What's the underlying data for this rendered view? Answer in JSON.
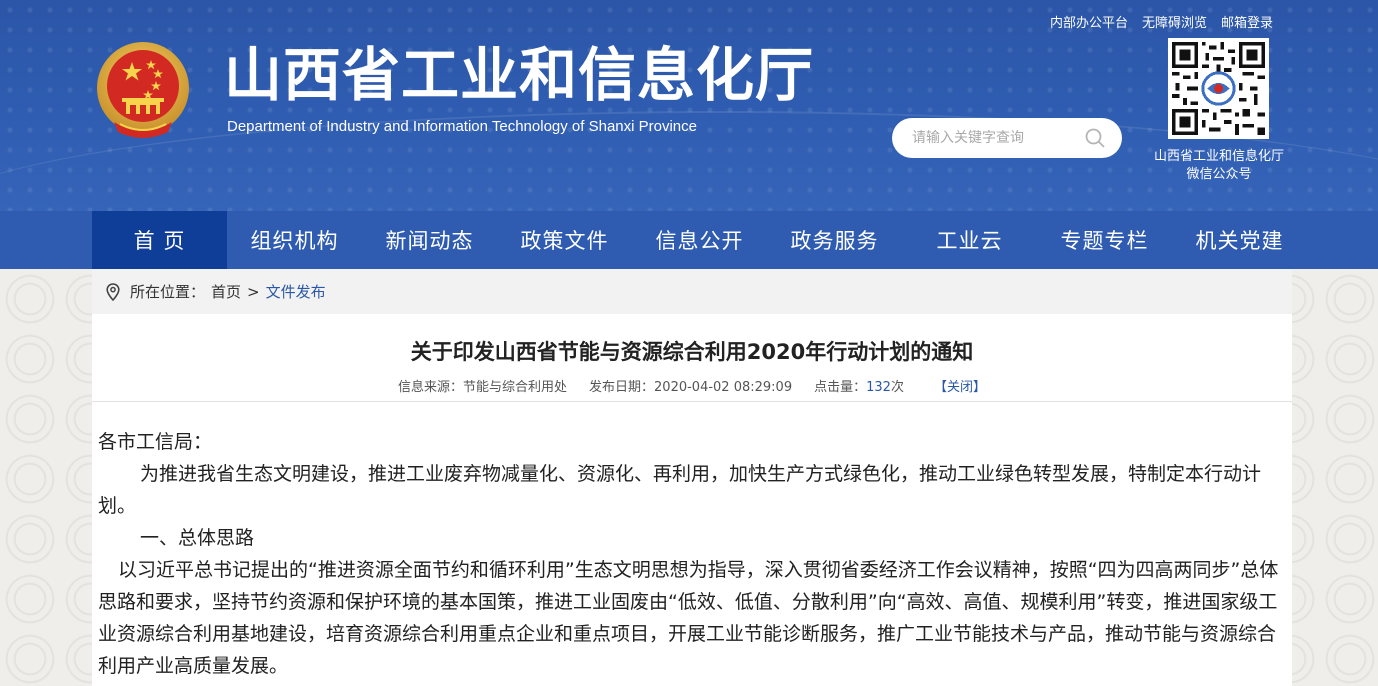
{
  "header": {
    "title": "山西省工业和信息化厅",
    "subtitle": "Department of Industry and Information Technology of Shanxi Province",
    "top_links": [
      "内部办公平台",
      "无障碍浏览",
      "邮箱登录"
    ],
    "search_placeholder": "请输入关键字查询",
    "qr_caption_line1": "山西省工业和信息化厅",
    "qr_caption_line2": "微信公众号"
  },
  "colors": {
    "header_bg": "#2f5db1",
    "nav_active": "#0f3e98",
    "link_blue": "#2a58a6"
  },
  "nav": {
    "items": [
      "首 页",
      "组织机构",
      "新闻动态",
      "政策文件",
      "信息公开",
      "政务服务",
      "工业云",
      "专题专栏",
      "机关党建"
    ],
    "active_index": 0
  },
  "breadcrumb": {
    "label": "所在位置：",
    "home": "首页",
    "separator": ">",
    "current": "文件发布"
  },
  "article": {
    "title": "关于印发山西省节能与资源综合利用2020年行动计划的通知",
    "source_label": "信息来源：节能与综合利用处",
    "date_label": "发布日期：2020-04-02 08:29:09",
    "clicks_prefix": "点击量：",
    "clicks_value": "132",
    "clicks_suffix": "次",
    "close_label": "【关闭】",
    "salutation": "各市工信局：",
    "para1": "为推进我省生态文明建设，推进工业废弃物减量化、资源化、再利用，加快生产方式绿色化，推动工业绿色转型发展，特制定本行动计划。",
    "section1": "一、总体思路",
    "para2": "以习近平总书记提出的“推进资源全面节约和循环利用”生态文明思想为指导，深入贯彻省委经济工作会议精神，按照“四为四高两同步”总体思路和要求，坚持节约资源和保护环境的基本国策，推进工业固废由“低效、低值、分散利用”向“高效、高值、规模利用”转变，推进国家级工业资源综合利用基地建设，培育资源综合利用重点企业和重点项目，开展工业节能诊断服务，推广工业节能技术与产品，推动节能与资源综合利用产业高质量发展。"
  }
}
